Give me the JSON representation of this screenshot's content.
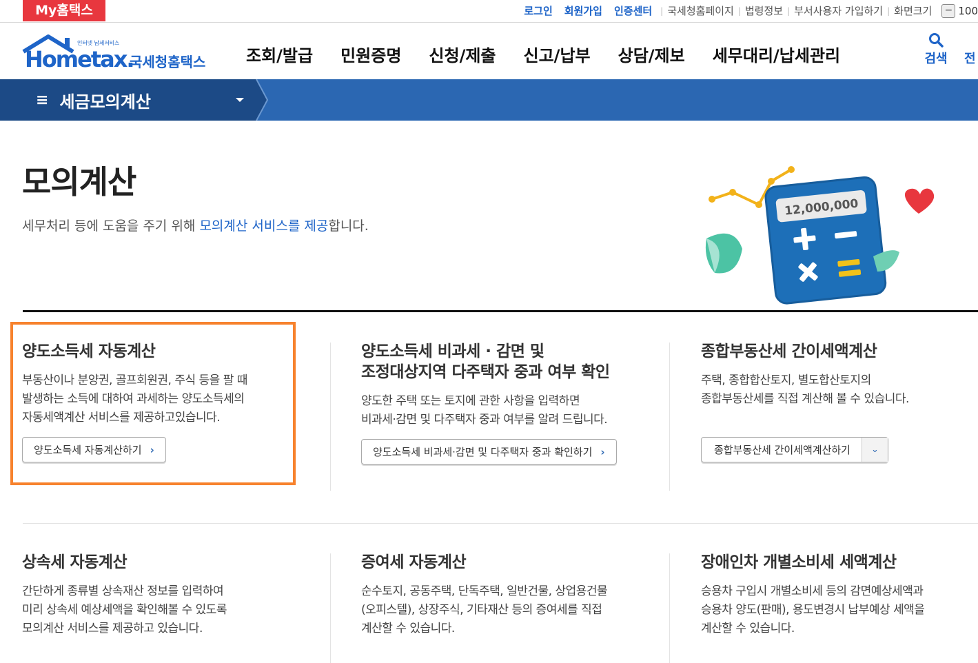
{
  "topbar": {
    "brand": "My홈택스",
    "links": [
      "로그인",
      "회원가입",
      "인증센터"
    ],
    "gray_links": [
      "국세청홈페이지",
      "법령정보",
      "부서사용자 가입하기",
      "화면크기"
    ],
    "zoom_minus": "−",
    "zoom_value": "100"
  },
  "header": {
    "logo_small": "인터넷 납세서비스",
    "logo_main": "Hometax.",
    "logo_sub": "국세청홈택스",
    "nav": [
      "조회/발급",
      "민원증명",
      "신청/제출",
      "신고/납부",
      "상담/제보",
      "세무대리/납세관리"
    ],
    "search_label": "검색",
    "all_label": "전"
  },
  "menubar": {
    "title": "세금모의계산",
    "hamburger": "≡"
  },
  "hero": {
    "title": "모의계산",
    "desc_pre": "세무처리 등에 도움을 주기 위해 ",
    "desc_hl": "모의계산 서비스를 제공",
    "desc_post": "합니다.",
    "calc_display": "12,000,000"
  },
  "cards": [
    {
      "title": "양도소득세 자동계산",
      "desc": [
        "부동산이나 분양권, 골프회원권, 주식 등을 팔 때",
        "발생하는 소득에 대하여 과세하는 양도소득세의",
        "자동세액계산 서비스를 제공하고있습니다."
      ],
      "button": "양도소득세 자동계산하기"
    },
    {
      "title": [
        "양도소득세 비과세 · 감면 및",
        "조정대상지역 다주택자 중과 여부 확인"
      ],
      "desc": [
        "양도한 주택 또는 토지에 관한 사항을 입력하면",
        "비과세·감면 및 다주택자 중과 여부를 알려 드립니다."
      ],
      "button": "양도소득세 비과세·감면 및 다주택자 중과 확인하기"
    },
    {
      "title": "종합부동산세 간이세액계산",
      "desc": [
        "주택, 종합합산토지, 별도합산토지의",
        "종합부동산세를 직접 계산해 볼 수 있습니다."
      ],
      "button": "종합부동산세 간이세액계산하기"
    },
    {
      "title": "상속세 자동계산",
      "desc": [
        "간단하게 종류별 상속재산 정보를 입력하여",
        "미리 상속세 예상세액을 확인해볼 수 있도록",
        "모의계산 서비스를 제공하고 있습니다."
      ]
    },
    {
      "title": "증여세 자동계산",
      "desc": [
        "순수토지, 공동주택, 단독주택, 일반건물, 상업용건물",
        "(오피스텔), 상장주식, 기타재산 등의 증여세를 직접",
        "계산할 수 있습니다."
      ]
    },
    {
      "title": "장애인차 개별소비세 세액계산",
      "desc": [
        "승용차 구입시 개별소비세 등의 감면예상세액과",
        "승용차 양도(판매), 용도변경시 납부예상 세액을",
        "계산할 수 있습니다."
      ]
    }
  ],
  "colors": {
    "brand_red": "#e8373e",
    "link_blue": "#1e64c8",
    "menubar_blue": "#2b67b2",
    "menubar_dark": "#1c4a86",
    "highlight_orange": "#f7822d"
  }
}
